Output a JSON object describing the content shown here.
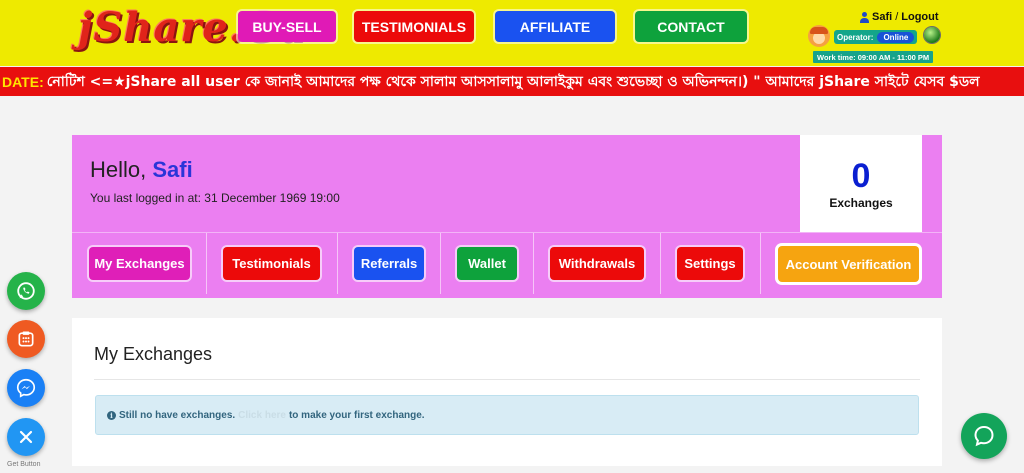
{
  "header": {
    "logo": "jShare.Ga",
    "nav": [
      "BUY-SELL",
      "TESTIMONIALS",
      "AFFILIATE",
      "CONTACT"
    ],
    "user_name": "Safi",
    "separator": "/",
    "logout": "Logout",
    "operator_label": "Operator:",
    "operator_status": "Online",
    "work_time": "Work time: 09:00 AM - 11:00 PM"
  },
  "ticker": {
    "label": "DATE:",
    "message": "নোটিশ <=★jShare all user কে জানাই আমাদের পক্ষ থেকে সালাম আসসালামু আলাইকুম এবং শুভেচ্ছা ও অভিনন্দন।) \" আমাদের jShare সাইটে যেসব $ডল"
  },
  "dashboard": {
    "hello": "Hello,",
    "user": "Safi",
    "last_login": "You last logged in at: 31 December 1969 19:00",
    "exchanges_count": "0",
    "exchanges_label": "Exchanges",
    "tabs": [
      "My Exchanges",
      "Testimonials",
      "Referrals",
      "Wallet",
      "Withdrawals",
      "Settings",
      "Account Verification"
    ]
  },
  "panel": {
    "title": "My Exchanges",
    "alert_text_1": "Still no have exchanges.",
    "alert_link": "Click here",
    "alert_text_2": "to make your first exchange."
  },
  "widgets": {
    "get_button": "Get Button"
  },
  "colors": {
    "header_bg": "#eeea00",
    "ticker_bg": "#e80f0f",
    "dashboard_bg": "#eb7ff1",
    "accent_blue": "#1a52f0",
    "accent_red": "#ec0a0a",
    "accent_green": "#0ea23c",
    "accent_pink": "#df1fb8",
    "accent_orange": "#f6a410"
  }
}
